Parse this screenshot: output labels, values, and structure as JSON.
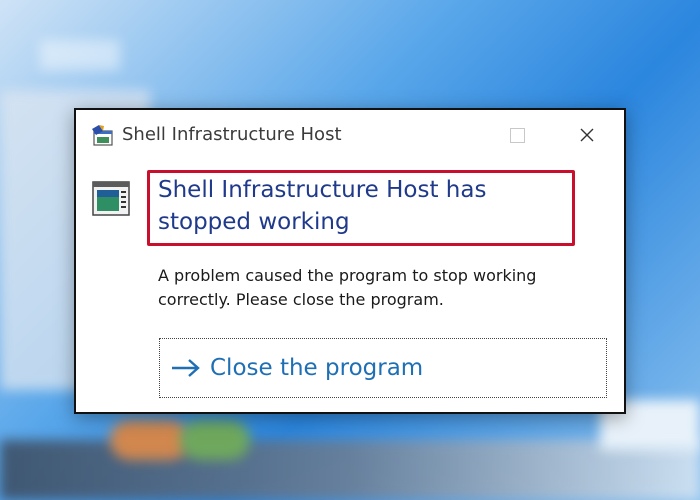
{
  "window": {
    "title": "Shell Infrastructure Host",
    "app_icon": "app-window-icon",
    "controls": {
      "maximize": "maximize-icon",
      "close": "close-icon"
    }
  },
  "error": {
    "headline": "Shell Infrastructure Host has stopped working",
    "message": "A problem caused the program to stop working correctly. Please close the program.",
    "icon": "program-window-icon",
    "highlight_color": "#c8102e",
    "headline_color": "#1f3a8a"
  },
  "actions": {
    "close_program": {
      "label": "Close the program",
      "icon": "arrow-right-icon",
      "color": "#1f6fb5"
    }
  }
}
